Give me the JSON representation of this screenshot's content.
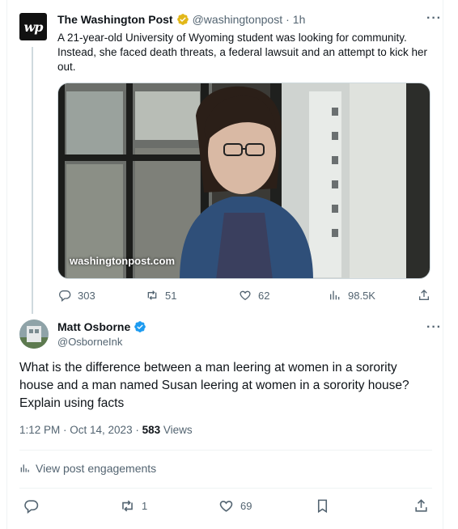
{
  "parent": {
    "name": "The Washington Post",
    "handle": "@washingtonpost",
    "time": "1h",
    "logo_text": "wp",
    "text": "A 21-year-old University of Wyoming student was looking for community. Instead, she faced death threats, a federal lawsuit and an attempt to kick her out.",
    "media_caption": "washingtonpost.com",
    "replies": "303",
    "reposts": "51",
    "likes": "62",
    "views": "98.5K"
  },
  "main": {
    "name": "Matt Osborne",
    "handle": "@OsborneInk",
    "text": "What is the difference between a man leering at women in a sorority house and a man named Susan leering at women in a sorority house? Explain using facts",
    "time": "1:12 PM · Oct 14, 2023",
    "separator": " · ",
    "views_count": "583",
    "views_label": " Views",
    "engagements_label": "View post engagements",
    "replies": "",
    "reposts": "1",
    "likes": "69"
  },
  "colors": {
    "blue_check": "#1d9bf0",
    "gold_check": "#e2b719",
    "muted": "#536471"
  },
  "icons": [
    "reply-icon",
    "repost-icon",
    "like-icon",
    "views-icon",
    "share-icon",
    "bookmark-icon",
    "more-icon",
    "verified-icon",
    "engagement-icon"
  ]
}
